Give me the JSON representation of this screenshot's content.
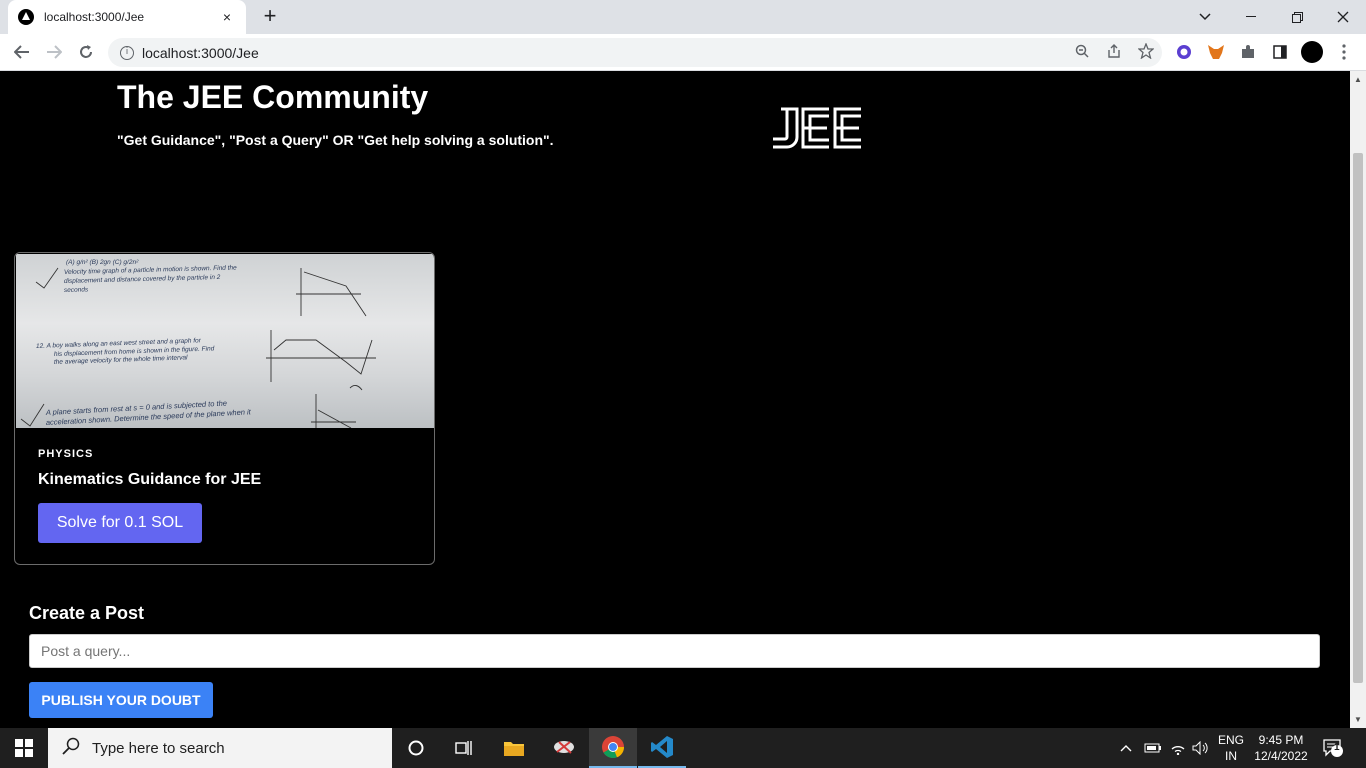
{
  "browser": {
    "tab_title": "localhost:3000/Jee",
    "tab_close": "×",
    "new_tab": "+",
    "url": "localhost:3000/Jee"
  },
  "page": {
    "title": "The JEE Community",
    "subtitle": "\"Get Guidance\", \"Post a Query\" OR \"Get help solving a solution\".",
    "logo_text": "JEE"
  },
  "post_card": {
    "category": "PHYSICS",
    "title": "Kinematics Guidance for JEE",
    "solve_label": "Solve for 0.1 SOL",
    "image_lines": [
      "(A) g/n²        (B) 2gn        (C) g/2n²",
      "Velocity time graph of a particle in motion is shown. Find the",
      "displacement and distance covered by the particle in 2",
      "seconds",
      "12.  A boy walks along an east west street and a graph for",
      "his displacement from home is shown in the figure. Find",
      "the average velocity for the whole time interval",
      "A plane starts from rest at s = 0 and is subjected to the",
      "acceleration shown. Determine the speed of the plane when it"
    ]
  },
  "create_post": {
    "heading": "Create a Post",
    "input_placeholder": "Post a query...",
    "input_value": "",
    "publish_label": "PUBLISH YOUR DOUBT"
  },
  "taskbar": {
    "search_placeholder": "Type here to search",
    "language_line1": "ENG",
    "language_line2": "IN",
    "time": "9:45 PM",
    "date": "12/4/2022",
    "notification_count": "1"
  }
}
